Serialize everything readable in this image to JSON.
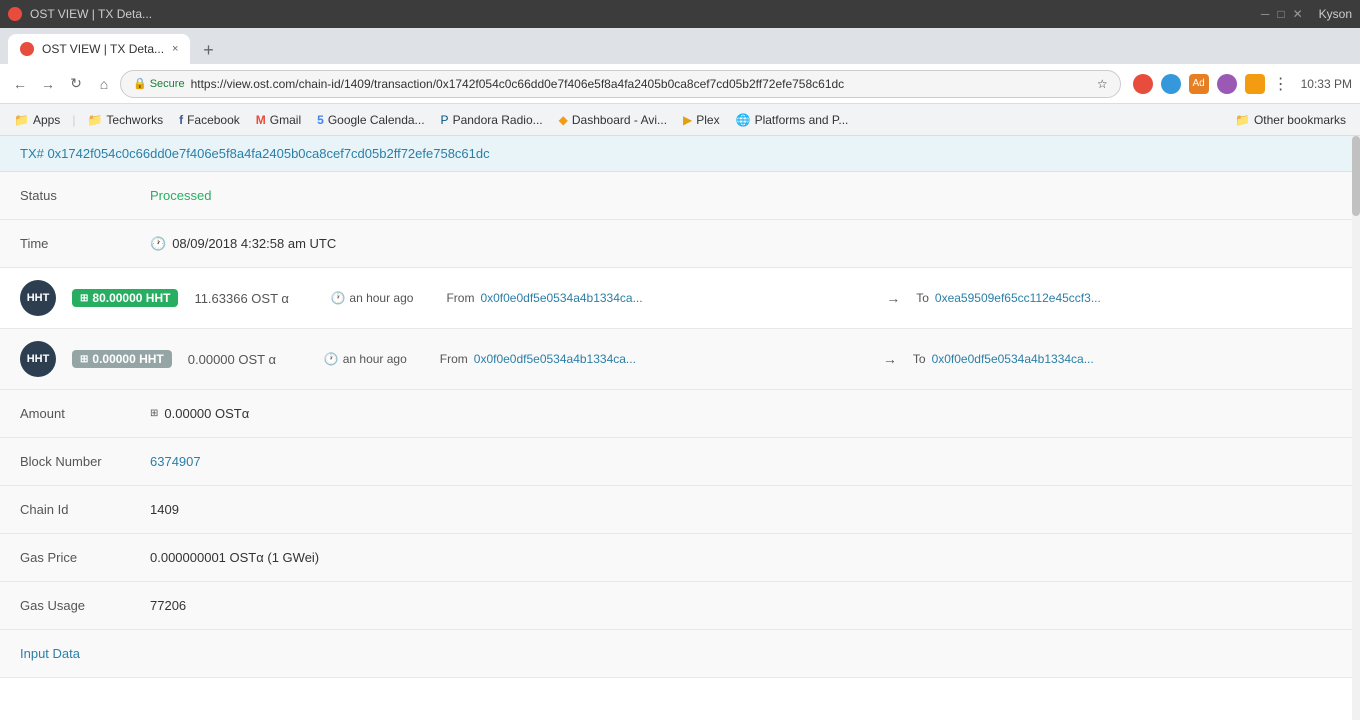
{
  "browser": {
    "title_bar": "OST VIEW | TX Deta...",
    "tab_label": "OST VIEW | TX Deta...",
    "tab_close": "×",
    "user": "Kyson",
    "back": "←",
    "forward": "→",
    "reload": "↻",
    "home": "⌂",
    "secure_label": "Secure",
    "url": "https://view.ost.com/chain-id/1409/transaction/0x1742f054c0c66dd0e7f406e5f8a4fa2405b0ca8cef7cd05b2ff72efe758c61dc",
    "time": "10:33 PM"
  },
  "bookmarks": [
    {
      "label": "Apps",
      "type": "folder",
      "id": "bm-apps"
    },
    {
      "label": "Techworks",
      "type": "folder",
      "id": "bm-techworks"
    },
    {
      "label": "Facebook",
      "type": "link",
      "id": "bm-facebook"
    },
    {
      "label": "Gmail",
      "type": "link",
      "id": "bm-gmail"
    },
    {
      "label": "Google Calenda...",
      "type": "link",
      "id": "bm-gcal"
    },
    {
      "label": "Pandora Radio...",
      "type": "link",
      "id": "bm-pandora"
    },
    {
      "label": "Dashboard - Avi...",
      "type": "link",
      "id": "bm-dashboard"
    },
    {
      "label": "Plex",
      "type": "link",
      "id": "bm-plex"
    },
    {
      "label": "Platforms and P...",
      "type": "link",
      "id": "bm-platforms"
    },
    {
      "label": "Other bookmarks",
      "type": "folder",
      "id": "bm-other"
    }
  ],
  "page": {
    "tx_hash": "TX# 0x1742f054c0c66dd0e7f406e5f8a4fa2405b0ca8cef7cd05b2ff72efe758c61dc",
    "status_label": "Status",
    "status_value": "Processed",
    "time_label": "Time",
    "time_value": "08/09/2018 4:32:58 am UTC",
    "transfers": [
      {
        "avatar": "HHT",
        "token_amount": "80.00000 HHT",
        "ost_amount": "11.63366 OST α",
        "time_ago": "an hour ago",
        "from_label": "From",
        "from_addr": "0x0f0e0df5e0534a4b1334ca...",
        "to_label": "To",
        "to_addr": "0xea59509ef65cc112e45ccf3...",
        "type": "positive"
      },
      {
        "avatar": "HHT",
        "token_amount": "0.00000 HHT",
        "ost_amount": "0.00000 OST α",
        "time_ago": "an hour ago",
        "from_label": "From",
        "from_addr": "0x0f0e0df5e0534a4b1334ca...",
        "to_label": "To",
        "to_addr": "0x0f0e0df5e0534a4b1334ca...",
        "type": "zero"
      }
    ],
    "amount_label": "Amount",
    "amount_value": "0.00000 OSTα",
    "block_number_label": "Block Number",
    "block_number_value": "6374907",
    "chain_id_label": "Chain Id",
    "chain_id_value": "1409",
    "gas_price_label": "Gas Price",
    "gas_price_value": "0.000000001 OSTα (1 GWei)",
    "gas_usage_label": "Gas Usage",
    "gas_usage_value": "77206",
    "input_data_label": "Input Data"
  }
}
